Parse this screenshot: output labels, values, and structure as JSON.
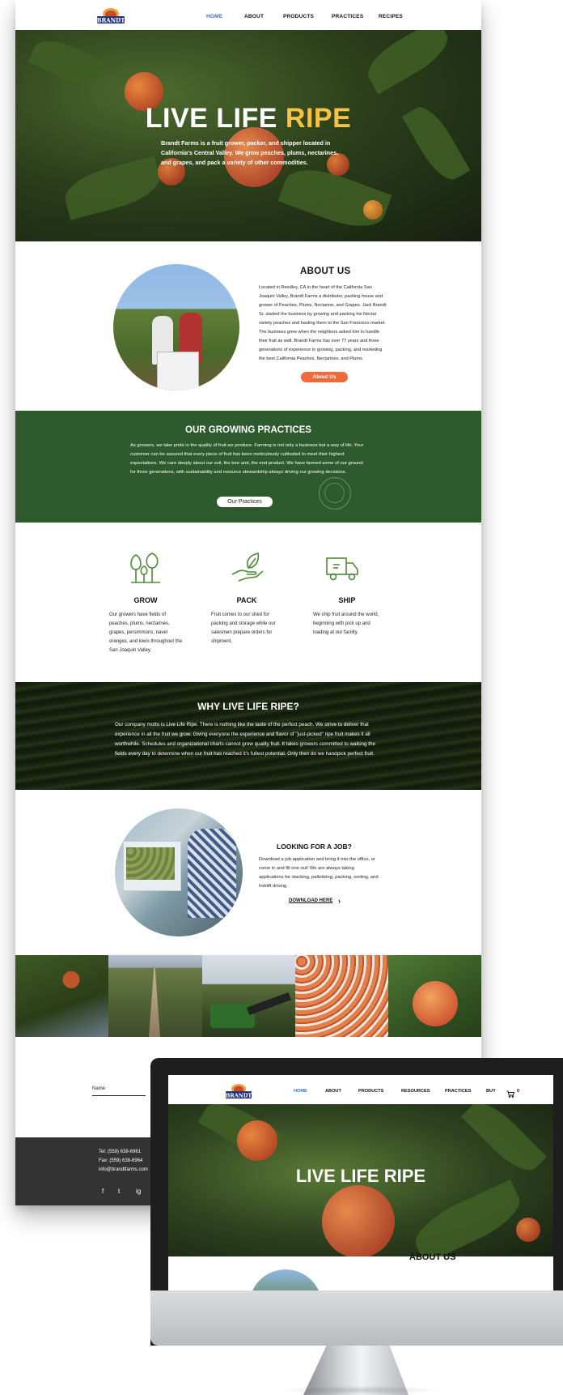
{
  "brand": {
    "logo_text": "BRANDT"
  },
  "nav": {
    "items": [
      "HOME",
      "ABOUT",
      "PRODUCTS",
      "PRACTICES",
      "RECIPES"
    ]
  },
  "hero": {
    "title_main": "LIVE LIFE",
    "title_accent": "RIPE",
    "text": "Brandt Farms is a fruit grower, packer, and shipper located in California's Central Valley. We grow peaches, plums, nectarines, and grapes, and pack a variety of other commodities."
  },
  "about": {
    "title": "ABOUT US",
    "text": "Located in Reedley, CA in the heart of the California San Joaquin Valley, Brandt Farms a distributer, packing house and grower of Peaches, Plums, Nectarine, and Grapes. Jack Brandt Sr. started the business by growing and packing his Nectar variety peaches and hauling them to the San Francisco market. The business grew when the neighbors asked him to handle their fruit as well. Brandt Farms has over 77 years and three generations of experience in growing, packing, and marketing the best California Peaches, Nectarines, and Plums.",
    "button": "About Us"
  },
  "practices": {
    "title": "OUR GROWING PRACTICES",
    "text": "As growers, we take pride in the quality of fruit we produce. Farming is not only a business but a way of life. Your customer can be assured that every piece of fruit has been meticulously cultivated to meet their highest expectations.  We care deeply about our soil, the tree and, the end product. We have farmed some of our ground for three generations, with sustainability and resource stewardship always driving our growing decisions.",
    "button": "Our Practices"
  },
  "services": [
    {
      "icon": "trees-icon",
      "title": "GROW",
      "text": "Our growers have fields of peaches, plums, nectarines, grapes, persimmons, navel oranges, and kiwis throughout the San Joaquin Valley."
    },
    {
      "icon": "hand-leaf-icon",
      "title": "PACK",
      "text": "Fruit comes to our shed for packing and storage while our salesmen prepare orders for shipment."
    },
    {
      "icon": "truck-icon",
      "title": "SHIP",
      "text": "We ship fruit around the world, beginning with pick up and loading at our facility."
    }
  ],
  "why": {
    "title": "WHY LIVE LIFE RIPE?",
    "text": "Our company motto is Live Life Ripe. There is nothing like the taste of the perfect peach. We strive to deliver that experience in all the fruit we grow. Giving everyone the experience and flavor of \"just-picked\" ripe fruit makes it all worthwhile. Schedules and organizational charts cannot grow quality fruit. It takes growers committed to walking the fields every day to determine when our fruit has reached it's fullest potential. Only then do we handpick perfect fruit."
  },
  "job": {
    "title": "LOOKING FOR A JOB?",
    "text": "Download a job application and bring it into the office, or come in and fill one out! We are always taking applications for stacking, palletizing, packing, sorting, and forklift driving.",
    "link": "DOWNLOAD HERE",
    "chevron": "›"
  },
  "contact": {
    "name_label": "Name"
  },
  "footer": {
    "tel": "Tel: (559) 638-6961",
    "fax": "Fax: (559) 638-6964",
    "email": "info@brandtfarms.com",
    "social": [
      "f",
      "t",
      "ig"
    ]
  },
  "monitor": {
    "nav_items": [
      "HOME",
      "ABOUT",
      "PRODUCTS",
      "RESOURCES",
      "PRACTICES",
      "BUY"
    ],
    "cart_count": "0",
    "hero_title": "LIVE LIFE RIPE",
    "about_title": "ABOUT US"
  },
  "colors": {
    "accent_blue": "#3b6fc1",
    "ripe_yellow": "#f5c242",
    "button_orange": "#ee6a3b",
    "practices_green": "#2e5b2e",
    "footer_gray": "#333333"
  }
}
